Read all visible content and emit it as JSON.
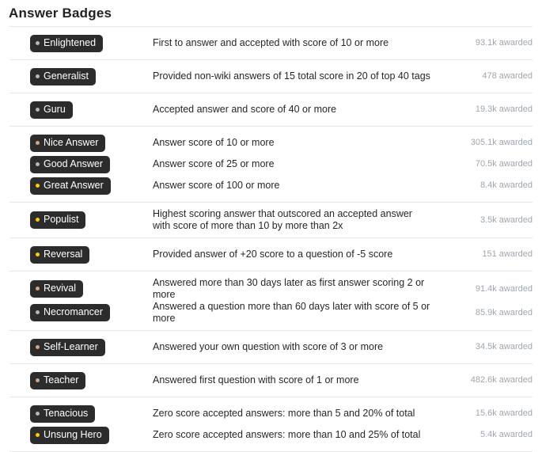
{
  "page": {
    "title": "Answer Badges",
    "awarded_suffix": "awarded"
  },
  "colors": {
    "pill_background": "#2c2c2c",
    "pill_text": "#ffffff",
    "gold": "#ffcc01",
    "silver": "#b4b8bc",
    "bronze": "#d1a684",
    "divider": "#e6e6e6",
    "description_text": "#242729",
    "count_text": "#9fa6ad",
    "title_text": "#222222"
  },
  "groups": [
    {
      "rows": [
        {
          "badge": "Enlightened",
          "tier": "silver",
          "description": "First to answer and accepted with score of 10 or more",
          "count": "93.1k awarded"
        }
      ]
    },
    {
      "rows": [
        {
          "badge": "Generalist",
          "tier": "silver",
          "description": "Provided non-wiki answers of 15 total score in 20 of top 40 tags",
          "count": "478 awarded"
        }
      ]
    },
    {
      "rows": [
        {
          "badge": "Guru",
          "tier": "silver",
          "description": "Accepted answer and score of 40 or more",
          "count": "19.3k awarded"
        }
      ]
    },
    {
      "rows": [
        {
          "badge": "Nice Answer",
          "tier": "bronze",
          "description": "Answer score of 10 or more",
          "count": "305.1k awarded"
        },
        {
          "badge": "Good Answer",
          "tier": "silver",
          "description": "Answer score of 25 or more",
          "count": "70.5k awarded"
        },
        {
          "badge": "Great Answer",
          "tier": "gold",
          "description": "Answer score of 100 or more",
          "count": "8.4k awarded"
        }
      ]
    },
    {
      "rows": [
        {
          "badge": "Populist",
          "tier": "gold",
          "description": "Highest scoring answer that outscored an accepted answer with score of more than 10 by more than 2x",
          "count": "3.5k awarded"
        }
      ]
    },
    {
      "rows": [
        {
          "badge": "Reversal",
          "tier": "gold",
          "description": "Provided answer of +20 score to a question of -5 score",
          "count": "151 awarded"
        }
      ]
    },
    {
      "rows": [
        {
          "badge": "Revival",
          "tier": "bronze",
          "description": "Answered more than 30 days later as first answer scoring 2 or more",
          "count": "91.4k awarded"
        },
        {
          "badge": "Necromancer",
          "tier": "silver",
          "description": "Answered a question more than 60 days later with score of 5 or more",
          "count": "85.9k awarded"
        }
      ]
    },
    {
      "rows": [
        {
          "badge": "Self-Learner",
          "tier": "bronze",
          "description": "Answered your own question with score of 3 or more",
          "count": "34.5k awarded"
        }
      ]
    },
    {
      "rows": [
        {
          "badge": "Teacher",
          "tier": "bronze",
          "description": "Answered first question with score of 1 or more",
          "count": "482.6k awarded"
        }
      ]
    },
    {
      "rows": [
        {
          "badge": "Tenacious",
          "tier": "silver",
          "description": "Zero score accepted answers: more than 5 and 20% of total",
          "count": "15.6k awarded"
        },
        {
          "badge": "Unsung Hero",
          "tier": "gold",
          "description": "Zero score accepted answers: more than 10 and 25% of total",
          "count": "5.4k awarded"
        }
      ]
    }
  ]
}
